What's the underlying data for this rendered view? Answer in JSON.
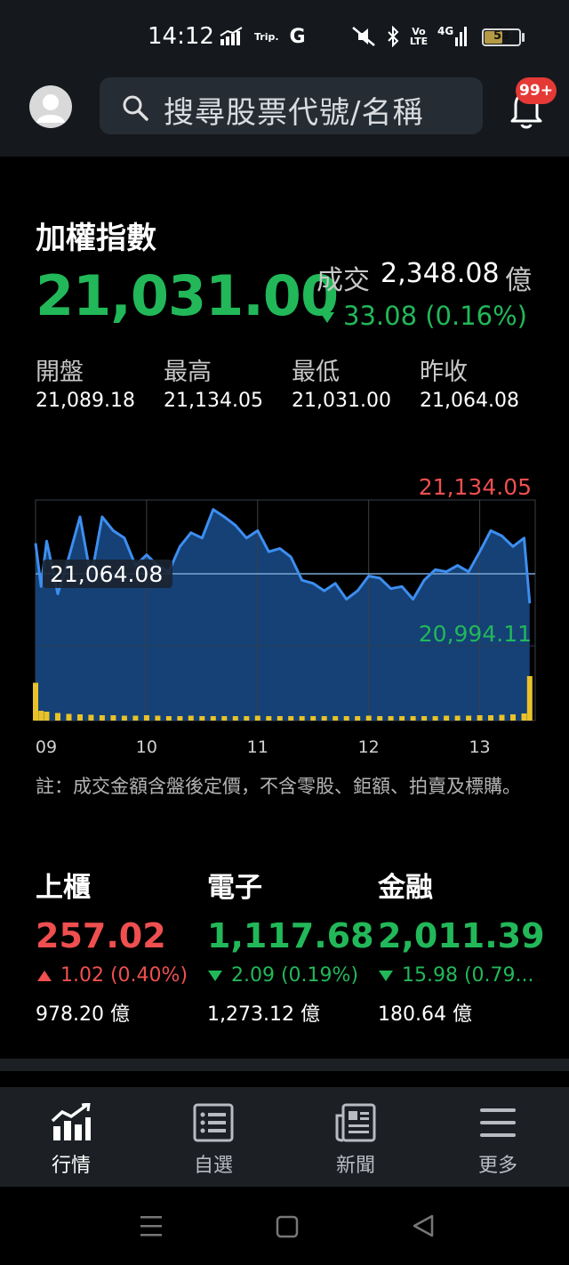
{
  "status_bar": {
    "time": "14:12",
    "trip_label": "Trip.",
    "g_label": "G",
    "volte_label": "Vo LTE",
    "network_label": "4G",
    "battery": "53",
    "battery_level": 0.53
  },
  "header": {
    "search_placeholder": "搜尋股票代號/名稱",
    "badge": "99+"
  },
  "index": {
    "title": "加權指數",
    "value": "21,031.00",
    "volume_label": "成交",
    "volume_value": "2,348.08",
    "volume_unit": "億",
    "change": "33.08 (0.16%)",
    "stats": [
      {
        "label": "開盤",
        "value": "21,089.18"
      },
      {
        "label": "最高",
        "value": "21,134.05"
      },
      {
        "label": "最低",
        "value": "21,031.00"
      },
      {
        "label": "昨收",
        "value": "21,064.08"
      }
    ]
  },
  "colors": {
    "up": "#ef4f4f",
    "down": "#22b859",
    "line": "#3d8ef0",
    "area": "#16457c",
    "volume": "#e8c228",
    "reference": "#7aa7d6"
  },
  "chart_data": {
    "type": "line",
    "x_ticks": [
      "09",
      "10",
      "11",
      "12",
      "13"
    ],
    "high_label": "21,134.05",
    "low_label": "20,994.11",
    "reference_label": "21,064.08",
    "reference_value": 21064.08,
    "ylim": [
      20994.11,
      21134.05
    ],
    "x": [
      9.0,
      9.05,
      9.1,
      9.2,
      9.3,
      9.4,
      9.5,
      9.6,
      9.7,
      9.8,
      9.9,
      10.0,
      10.1,
      10.2,
      10.3,
      10.4,
      10.5,
      10.6,
      10.7,
      10.8,
      10.9,
      11.0,
      11.1,
      11.2,
      11.3,
      11.4,
      11.5,
      11.6,
      11.7,
      11.8,
      11.9,
      12.0,
      12.1,
      12.2,
      12.3,
      12.4,
      12.5,
      12.6,
      12.7,
      12.8,
      12.9,
      13.0,
      13.1,
      13.2,
      13.3,
      13.4,
      13.45
    ],
    "y": [
      21093,
      21052,
      21095,
      21045,
      21080,
      21118,
      21060,
      21118,
      21105,
      21098,
      21072,
      21082,
      21072,
      21066,
      21090,
      21103,
      21098,
      21125,
      21118,
      21110,
      21098,
      21105,
      21085,
      21088,
      21080,
      21058,
      21055,
      21048,
      21055,
      21040,
      21048,
      21062,
      21060,
      21050,
      21052,
      21040,
      21058,
      21068,
      21066,
      21072,
      21066,
      21085,
      21105,
      21100,
      21090,
      21098,
      21036
    ],
    "volume": [
      0.85,
      0.22,
      0.2,
      0.17,
      0.15,
      0.14,
      0.13,
      0.12,
      0.12,
      0.11,
      0.11,
      0.12,
      0.11,
      0.1,
      0.1,
      0.11,
      0.1,
      0.1,
      0.1,
      0.1,
      0.1,
      0.11,
      0.1,
      0.1,
      0.1,
      0.1,
      0.1,
      0.1,
      0.1,
      0.1,
      0.1,
      0.11,
      0.1,
      0.1,
      0.1,
      0.1,
      0.1,
      0.1,
      0.11,
      0.11,
      0.11,
      0.12,
      0.12,
      0.13,
      0.14,
      0.16,
      1.0
    ]
  },
  "note": "註：成交金額含盤後定價，不含零股、鉅額、拍賣及標購。",
  "sub_indices": [
    {
      "name": "上櫃",
      "value": "257.02",
      "dir": "up",
      "change": "1.02 (0.40%)",
      "volume": "978.20 億"
    },
    {
      "name": "電子",
      "value": "1,117.68",
      "dir": "down",
      "change": "2.09 (0.19%)",
      "volume": "1,273.12 億"
    },
    {
      "name": "金融",
      "value": "2,011.39",
      "dir": "down",
      "change": "15.98 (0.79...",
      "volume": "180.64 億"
    }
  ],
  "nav": [
    {
      "label": "行情",
      "icon": "chart-icon",
      "active": true
    },
    {
      "label": "自選",
      "icon": "list-icon",
      "active": false
    },
    {
      "label": "新聞",
      "icon": "news-icon",
      "active": false
    },
    {
      "label": "更多",
      "icon": "menu-icon",
      "active": false
    }
  ]
}
